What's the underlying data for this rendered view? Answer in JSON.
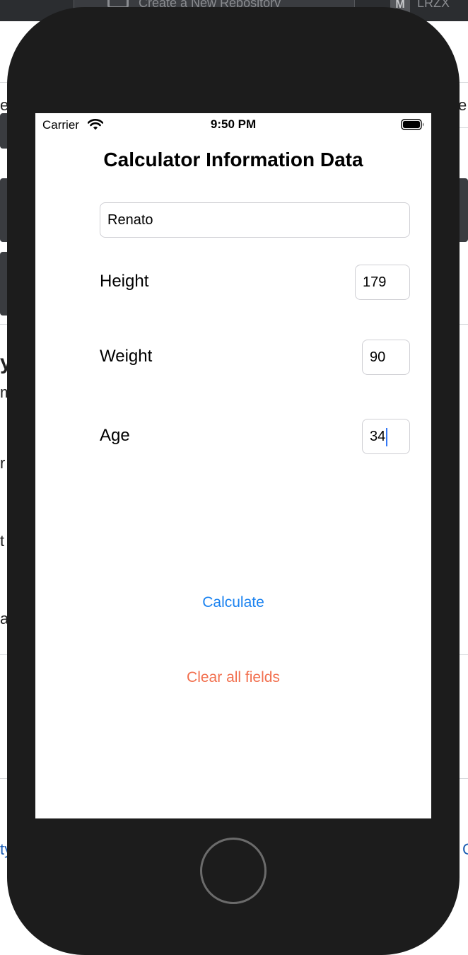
{
  "background": {
    "tab_title": "Create a New Repository",
    "badge": "M",
    "right_text": "LRZX",
    "fragments": [
      "er",
      "e",
      "it",
      "y",
      "m",
      "r",
      "t",
      "a",
      "ty",
      "C"
    ]
  },
  "status_bar": {
    "carrier": "Carrier",
    "time": "9:50 PM"
  },
  "app": {
    "title": "Calculator Information Data",
    "name_value": "Renato",
    "height": {
      "label": "Height",
      "value": "179"
    },
    "weight": {
      "label": "Weight",
      "value": "90"
    },
    "age": {
      "label": "Age",
      "value": "34"
    },
    "calculate_label": "Calculate",
    "clear_label": "Clear all fields"
  },
  "colors": {
    "calculate": "#1a82f0",
    "clear": "#f2704f",
    "caret": "#3478f6"
  }
}
